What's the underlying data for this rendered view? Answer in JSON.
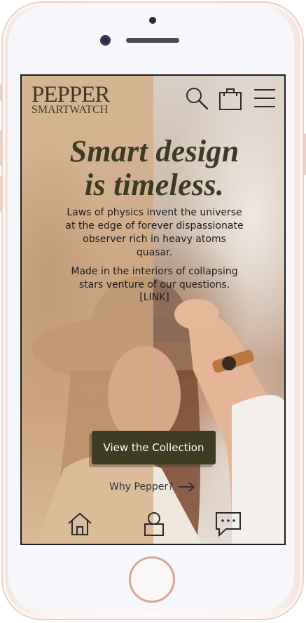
{
  "brand": {
    "name": "PEPPER",
    "subtitle": "SMARTWATCH"
  },
  "header": {
    "icons": [
      "search-icon",
      "shopping-bag-icon",
      "hamburger-menu-icon"
    ]
  },
  "hero": {
    "headline_line1": "Smart design",
    "headline_line2": "is timeless.",
    "paragraph1": "Laws of physics invent the universe at the edge of forever dispassionate observer rich in heavy atoms quasar.",
    "paragraph2": "Made in the interiors of collapsing stars venture of our questions.",
    "link_label": "[LINK]",
    "cta_label": "View the Collection",
    "secondary_label": "Why Pepper?"
  },
  "bottom_nav": {
    "items": [
      "home-icon",
      "profile-icon",
      "chat-icon"
    ]
  },
  "colors": {
    "accent_dark_olive": "#3f3c22",
    "overlay_tan": "#d4aa80",
    "text_dark": "#1d1d1d"
  }
}
